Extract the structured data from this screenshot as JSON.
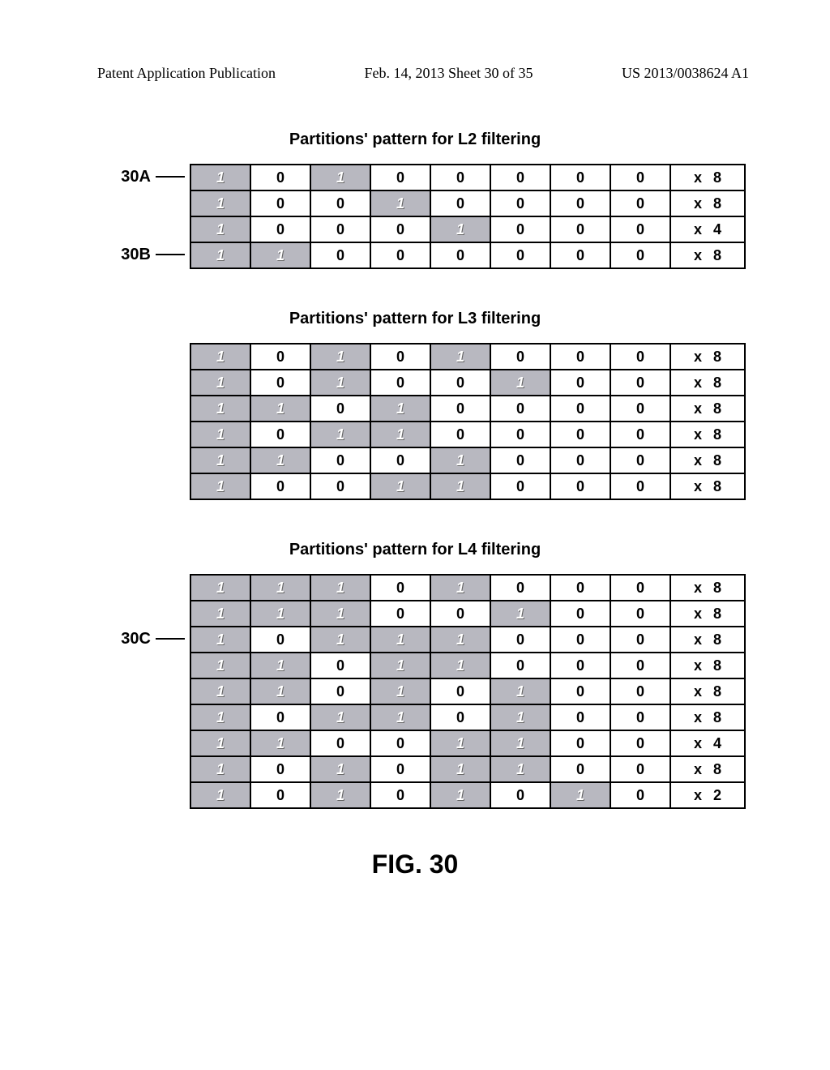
{
  "header": {
    "left": "Patent Application Publication",
    "center": "Feb. 14, 2013  Sheet 30 of 35",
    "right": "US 2013/0038624 A1"
  },
  "figure_label": "FIG. 30",
  "sections": [
    {
      "title": "Partitions' pattern for L2 filtering",
      "callouts": [
        {
          "row": 0,
          "label": "30A"
        },
        {
          "row": 3,
          "label": "30B"
        }
      ],
      "rows": [
        {
          "cells": [
            1,
            0,
            1,
            0,
            0,
            0,
            0,
            0
          ],
          "mult": 8
        },
        {
          "cells": [
            1,
            0,
            0,
            1,
            0,
            0,
            0,
            0
          ],
          "mult": 8
        },
        {
          "cells": [
            1,
            0,
            0,
            0,
            1,
            0,
            0,
            0
          ],
          "mult": 4
        },
        {
          "cells": [
            1,
            1,
            0,
            0,
            0,
            0,
            0,
            0
          ],
          "mult": 8
        }
      ]
    },
    {
      "title": "Partitions' pattern for L3 filtering",
      "callouts": [],
      "rows": [
        {
          "cells": [
            1,
            0,
            1,
            0,
            1,
            0,
            0,
            0
          ],
          "mult": 8
        },
        {
          "cells": [
            1,
            0,
            1,
            0,
            0,
            1,
            0,
            0
          ],
          "mult": 8
        },
        {
          "cells": [
            1,
            1,
            0,
            1,
            0,
            0,
            0,
            0
          ],
          "mult": 8
        },
        {
          "cells": [
            1,
            0,
            1,
            1,
            0,
            0,
            0,
            0
          ],
          "mult": 8
        },
        {
          "cells": [
            1,
            1,
            0,
            0,
            1,
            0,
            0,
            0
          ],
          "mult": 8
        },
        {
          "cells": [
            1,
            0,
            0,
            1,
            1,
            0,
            0,
            0
          ],
          "mult": 8
        }
      ]
    },
    {
      "title": "Partitions' pattern for L4 filtering",
      "callouts": [
        {
          "row": 2,
          "label": "30C"
        }
      ],
      "rows": [
        {
          "cells": [
            1,
            1,
            1,
            0,
            1,
            0,
            0,
            0
          ],
          "mult": 8
        },
        {
          "cells": [
            1,
            1,
            1,
            0,
            0,
            1,
            0,
            0
          ],
          "mult": 8
        },
        {
          "cells": [
            1,
            0,
            1,
            1,
            1,
            0,
            0,
            0
          ],
          "mult": 8
        },
        {
          "cells": [
            1,
            1,
            0,
            1,
            1,
            0,
            0,
            0
          ],
          "mult": 8
        },
        {
          "cells": [
            1,
            1,
            0,
            1,
            0,
            1,
            0,
            0
          ],
          "mult": 8
        },
        {
          "cells": [
            1,
            0,
            1,
            1,
            0,
            1,
            0,
            0
          ],
          "mult": 8
        },
        {
          "cells": [
            1,
            1,
            0,
            0,
            1,
            1,
            0,
            0
          ],
          "mult": 4
        },
        {
          "cells": [
            1,
            0,
            1,
            0,
            1,
            1,
            0,
            0
          ],
          "mult": 8
        },
        {
          "cells": [
            1,
            0,
            1,
            0,
            1,
            0,
            1,
            0
          ],
          "mult": 2
        }
      ]
    }
  ],
  "labels": {
    "mult_x": "x"
  }
}
